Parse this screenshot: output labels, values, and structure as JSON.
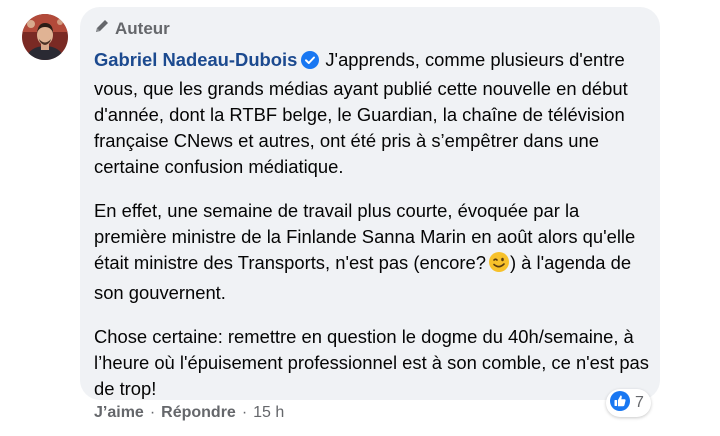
{
  "comment": {
    "author_badge_label": "Auteur",
    "author_name": "Gabriel Nadeau-Dubois",
    "paragraphs": [
      "J'apprends, comme plusieurs d'entre vous, que les grands médias ayant publié cette nouvelle en début d'année, dont la RTBF belge, le Guardian, la chaîne de télévision française CNews et autres, ont été pris à s’empêtrer dans une certaine confusion médiatique.",
      "En effet, une semaine de travail plus courte, évoquée par la première ministre de la Finlande Sanna Marin en août alors qu'elle était ministre des Transports, n'est pas (encore?",
      ") à l'agenda de son gouvernent.",
      "Chose certaine: remettre en question le dogme du 40h/semaine, à l’heure où l'épuisement professionnel est à son comble, ce n'est pas de trop!"
    ],
    "reactions": {
      "icon": "like-icon",
      "count": "7"
    },
    "actions": {
      "like_label": "J’aime",
      "reply_label": "Répondre",
      "separator": "·",
      "timestamp": "15 h"
    }
  },
  "colors": {
    "bubble_bg": "#f0f2f5",
    "name_color": "#1c4a8f",
    "meta_gray": "#65676b",
    "like_blue": "#1877f2"
  }
}
